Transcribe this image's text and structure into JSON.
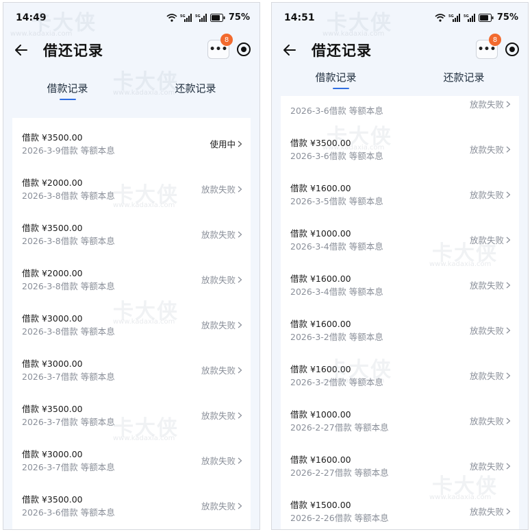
{
  "watermark": {
    "logo_text": "卡大侠",
    "url_text": "www.kadaxia.com"
  },
  "screens": [
    {
      "status_bar": {
        "time": "14:49",
        "battery": "75%"
      },
      "header": {
        "title": "借还记录",
        "badge_count": "8",
        "more_label": "•••"
      },
      "tabs": [
        {
          "label": "借款记录",
          "active": true
        },
        {
          "label": "还款记录",
          "active": false
        }
      ],
      "items": [
        {
          "amount": "借款 ¥3500.00",
          "desc": "2026-3-9借款 等额本息",
          "status": "使用中"
        },
        {
          "amount": "借款 ¥2000.00",
          "desc": "2026-3-8借款 等额本息",
          "status": "放款失败"
        },
        {
          "amount": "借款 ¥3500.00",
          "desc": "2026-3-8借款 等额本息",
          "status": "放款失败"
        },
        {
          "amount": "借款 ¥2000.00",
          "desc": "2026-3-8借款 等额本息",
          "status": "放款失败"
        },
        {
          "amount": "借款 ¥3000.00",
          "desc": "2026-3-8借款 等额本息",
          "status": "放款失败"
        },
        {
          "amount": "借款 ¥3000.00",
          "desc": "2026-3-7借款 等额本息",
          "status": "放款失败"
        },
        {
          "amount": "借款 ¥3500.00",
          "desc": "2026-3-7借款 等额本息",
          "status": "放款失败"
        },
        {
          "amount": "借款 ¥3000.00",
          "desc": "2026-3-7借款 等额本息",
          "status": "放款失败"
        },
        {
          "amount": "借款 ¥3500.00",
          "desc": "2026-3-6借款 等额本息",
          "status": "放款失败"
        }
      ]
    },
    {
      "status_bar": {
        "time": "14:51",
        "battery": "75%"
      },
      "header": {
        "title": "借还记录",
        "badge_count": "8",
        "more_label": "•••"
      },
      "tabs": [
        {
          "label": "借款记录",
          "active": true
        },
        {
          "label": "还款记录",
          "active": false
        }
      ],
      "items": [
        {
          "amount": "",
          "desc": "2026-3-6借款 等额本息",
          "status": "放款失败"
        },
        {
          "amount": "借款 ¥3500.00",
          "desc": "2026-3-6借款 等额本息",
          "status": "放款失败"
        },
        {
          "amount": "借款 ¥1600.00",
          "desc": "2026-3-5借款 等额本息",
          "status": "放款失败"
        },
        {
          "amount": "借款 ¥1000.00",
          "desc": "2026-3-4借款 等额本息",
          "status": "放款失败"
        },
        {
          "amount": "借款 ¥1600.00",
          "desc": "2026-3-4借款 等额本息",
          "status": "放款失败"
        },
        {
          "amount": "借款 ¥1600.00",
          "desc": "2026-3-2借款 等额本息",
          "status": "放款失败"
        },
        {
          "amount": "借款 ¥1600.00",
          "desc": "2026-3-2借款 等额本息",
          "status": "放款失败"
        },
        {
          "amount": "借款 ¥1000.00",
          "desc": "2026-2-27借款 等额本息",
          "status": "放款失败"
        },
        {
          "amount": "借款 ¥1600.00",
          "desc": "2026-2-27借款 等额本息",
          "status": "放款失败"
        },
        {
          "amount": "借款 ¥1500.00",
          "desc": "2026-2-26借款 等额本息",
          "status": "放款失败"
        }
      ]
    }
  ],
  "colors": {
    "accent": "#2f6de1",
    "badge": "#f26a2e",
    "muted_text": "#8a8f99",
    "page_bg": "#f2f6fc"
  }
}
